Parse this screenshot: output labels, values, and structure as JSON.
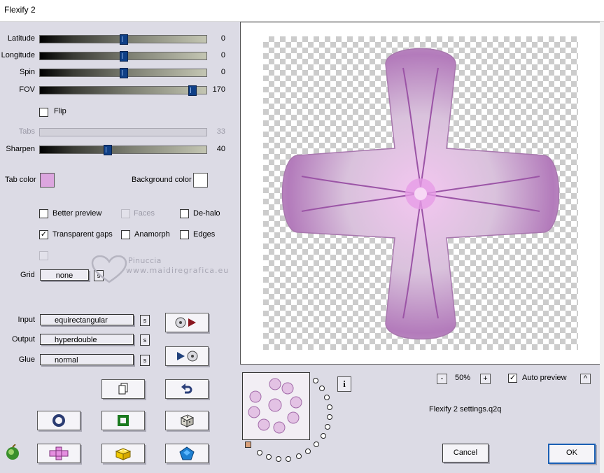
{
  "window": {
    "title": "Flexify 2"
  },
  "sliders": [
    {
      "key": "latitude",
      "label": "Latitude",
      "value": "0",
      "fraction": 0.5,
      "disabled": false
    },
    {
      "key": "longitude",
      "label": "Longitude",
      "value": "0",
      "fraction": 0.5,
      "disabled": false
    },
    {
      "key": "spin",
      "label": "Spin",
      "value": "0",
      "fraction": 0.5,
      "disabled": false
    },
    {
      "key": "fov",
      "label": "FOV",
      "value": "170",
      "fraction": 0.93,
      "disabled": false
    },
    {
      "key": "tabs",
      "label": "Tabs",
      "value": "33",
      "fraction": 0.33,
      "disabled": true
    },
    {
      "key": "sharpen",
      "label": "Sharpen",
      "value": "40",
      "fraction": 0.4,
      "disabled": false
    }
  ],
  "flip": {
    "label": "Flip",
    "checked": false
  },
  "colors": {
    "tab_color_label": "Tab color",
    "tab_color": "#dca6df",
    "background_color_label": "Background color",
    "background_color": "#ffffff"
  },
  "options": {
    "better_preview": {
      "label": "Better preview",
      "checked": false
    },
    "faces": {
      "label": "Faces",
      "checked": false,
      "disabled": true
    },
    "de_halo": {
      "label": "De-halo",
      "checked": false
    },
    "transparent_gaps": {
      "label": "Transparent gaps",
      "checked": true
    },
    "anamorph": {
      "label": "Anamorph",
      "checked": false
    },
    "edges": {
      "label": "Edges",
      "checked": false
    }
  },
  "grid": {
    "label": "Grid",
    "value": "none",
    "s_label": "s"
  },
  "watermark": {
    "name": "Pinuccia",
    "url": "www.maidiregrafica.eu"
  },
  "mapping": {
    "input": {
      "label": "Input",
      "value": "equirectangular"
    },
    "output": {
      "label": "Output",
      "value": "hyperdouble"
    },
    "glue": {
      "label": "Glue",
      "value": "normal"
    },
    "s_label": "s"
  },
  "preview": {
    "zoom": "50%",
    "zoom_minus": "-",
    "zoom_plus": "+",
    "auto_preview": {
      "label": "Auto preview",
      "checked": true
    },
    "settings_file": "Flexify 2 settings.q2q",
    "info_label": "i",
    "collapse_label": "^"
  },
  "dialog_buttons": {
    "cancel": "Cancel",
    "ok": "OK"
  },
  "accent": {
    "slider_thumb": "#0f3f86",
    "preview_tint": "#c98ed0",
    "dialog_bg": "#dcdbe5"
  }
}
